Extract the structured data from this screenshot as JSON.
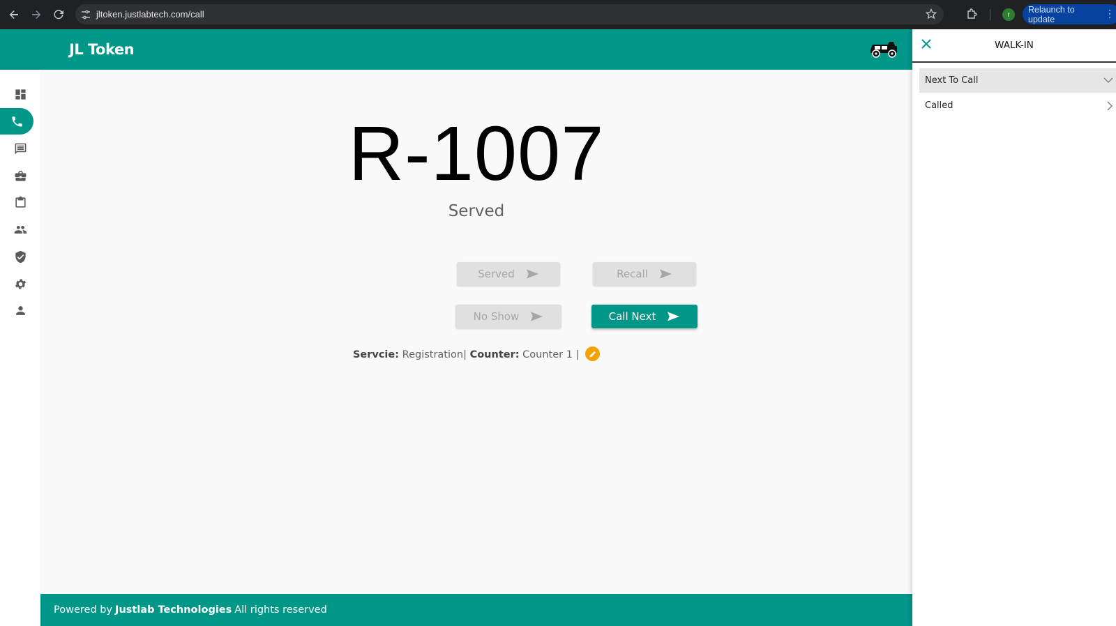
{
  "browser": {
    "url": "jltoken.justlabtech.com/call",
    "relaunch_label": "Relaunch to update",
    "profile_initial": "r"
  },
  "app": {
    "brand": "JL Token"
  },
  "sidebar": {
    "items": [
      {
        "icon": "dashboard-icon"
      },
      {
        "icon": "phone-icon",
        "active": true
      },
      {
        "icon": "message-icon"
      },
      {
        "icon": "briefcase-icon"
      },
      {
        "icon": "clipboard-icon"
      },
      {
        "icon": "people-icon"
      },
      {
        "icon": "shield-icon"
      },
      {
        "icon": "gear-icon"
      },
      {
        "icon": "person-icon"
      }
    ]
  },
  "main": {
    "token_number": "R-1007",
    "token_status": "Served",
    "buttons": {
      "served": "Served",
      "recall": "Recall",
      "no_show": "No Show",
      "call_next": "Call Next"
    },
    "info": {
      "service_label": "Servcie:",
      "service_value": "Registration|",
      "counter_label": "Counter:",
      "counter_value": "Counter 1 |"
    }
  },
  "footer": {
    "prefix": "Powered by",
    "company": "Justlab Technologies",
    "suffix": "All rights reserved"
  },
  "drawer": {
    "title": "WALK-IN",
    "sections": {
      "next_to_call": "Next To Call",
      "called": "Called"
    }
  },
  "colors": {
    "primary": "#009688",
    "edit_badge": "#f5a100",
    "chrome_bg": "#202124"
  }
}
